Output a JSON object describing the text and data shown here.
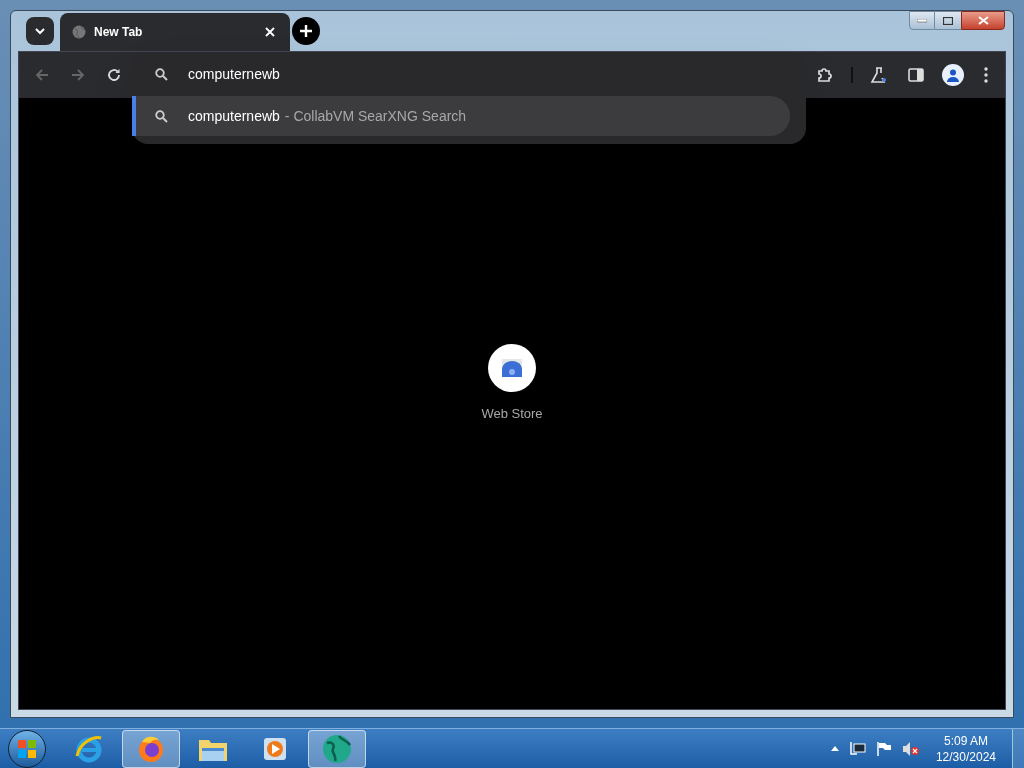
{
  "browser": {
    "tab": {
      "title": "New Tab",
      "selected": true
    },
    "omnibox": {
      "value": "computernewb"
    },
    "suggestions": [
      {
        "query": "computernewb",
        "description": "- CollabVM SearXNG Search",
        "selected": true
      }
    ],
    "shortcuts": [
      {
        "label": "Web Store"
      }
    ]
  },
  "taskbar": {
    "apps": [
      {
        "kind": "ie",
        "selected": false
      },
      {
        "kind": "firefox",
        "selected": true
      },
      {
        "kind": "folder",
        "selected": false
      },
      {
        "kind": "media",
        "selected": false
      },
      {
        "kind": "globe",
        "selected": true
      }
    ],
    "clock": {
      "time": "5:09 AM",
      "date": "12/30/2024"
    }
  }
}
